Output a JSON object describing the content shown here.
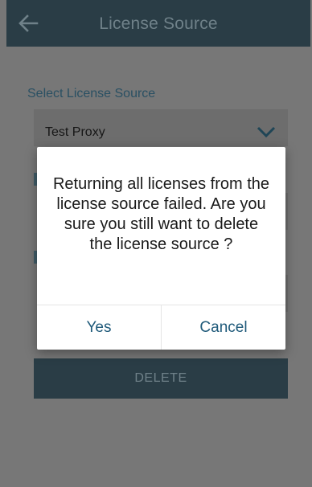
{
  "header": {
    "title": "License Source",
    "back_icon": "arrow-left-icon"
  },
  "form": {
    "source_label": "Select License Source",
    "selected_source": "Test Proxy",
    "dropdown_icon": "chevron-down-icon"
  },
  "dialog": {
    "message": "Returning all licenses from the license source failed. Are you sure you still want to delete the license source ?",
    "yes_label": "Yes",
    "cancel_label": "Cancel"
  },
  "actions": {
    "delete_label": "DELETE"
  },
  "colors": {
    "header_bg": "#2a3d46",
    "accent": "#1f5a7a",
    "overlay": "#777777",
    "dialog_bg": "#ffffff"
  }
}
